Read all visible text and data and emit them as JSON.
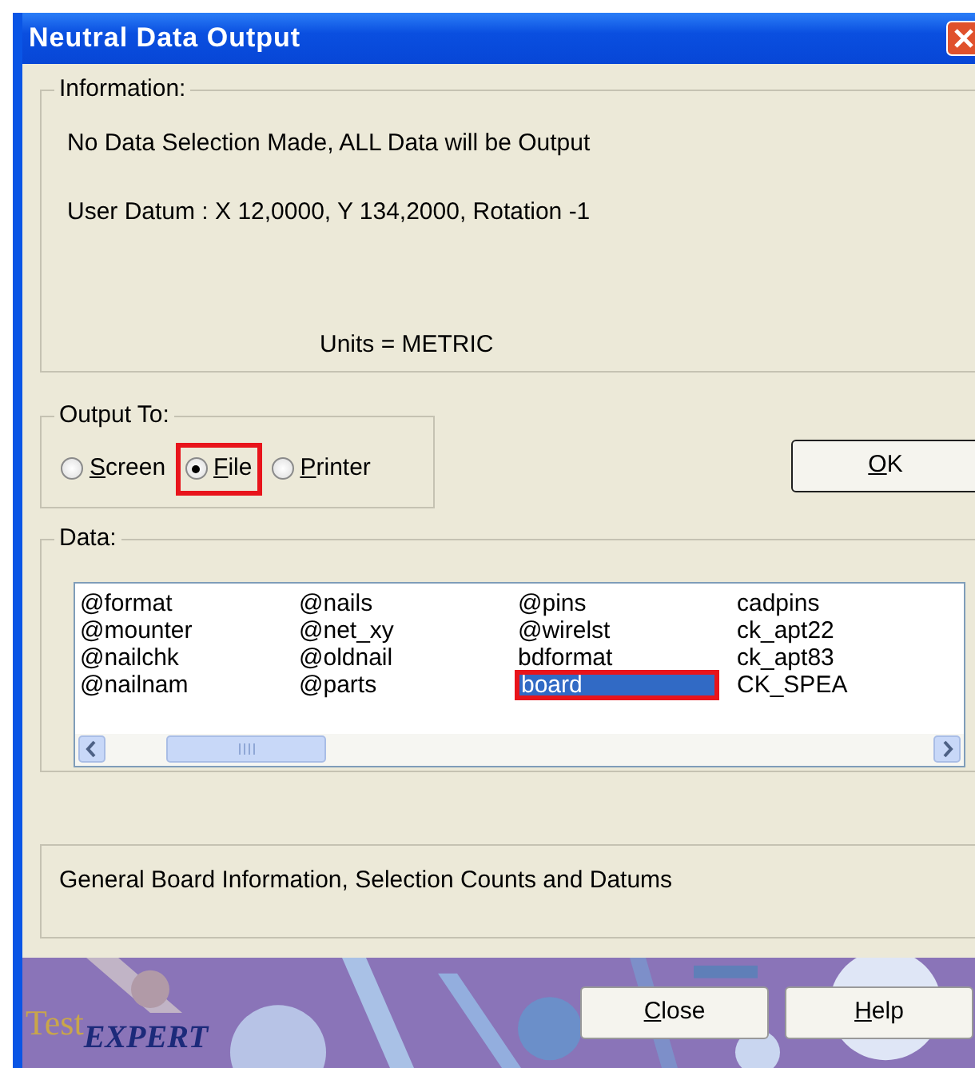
{
  "window": {
    "title": "Neutral Data Output"
  },
  "information": {
    "label": "Information:",
    "lines": [
      "No Data Selection Made, ALL Data will be Output",
      "User Datum : X 12,0000, Y 134,2000, Rotation -1"
    ],
    "units": "Units = METRIC"
  },
  "output_to": {
    "label": "Output To:",
    "options": [
      {
        "label": "Screen",
        "underline_first": true,
        "selected": false,
        "highlighted": false
      },
      {
        "label": "File",
        "underline_first": true,
        "selected": true,
        "highlighted": true
      },
      {
        "label": "Printer",
        "underline_first": true,
        "selected": false,
        "highlighted": false
      }
    ]
  },
  "ok_button": {
    "label": "OK",
    "underline_first": true
  },
  "data": {
    "label": "Data:",
    "columns": [
      [
        {
          "text": "@format",
          "selected": false,
          "highlighted": false
        },
        {
          "text": "@mounter",
          "selected": false,
          "highlighted": false
        },
        {
          "text": "@nailchk",
          "selected": false,
          "highlighted": false
        },
        {
          "text": "@nailnam",
          "selected": false,
          "highlighted": false
        }
      ],
      [
        {
          "text": "@nails",
          "selected": false,
          "highlighted": false
        },
        {
          "text": "@net_xy",
          "selected": false,
          "highlighted": false
        },
        {
          "text": "@oldnail",
          "selected": false,
          "highlighted": false
        },
        {
          "text": "@parts",
          "selected": false,
          "highlighted": false
        }
      ],
      [
        {
          "text": "@pins",
          "selected": false,
          "highlighted": false
        },
        {
          "text": "@wirelst",
          "selected": false,
          "highlighted": false
        },
        {
          "text": "bdformat",
          "selected": false,
          "highlighted": false
        },
        {
          "text": "board",
          "selected": true,
          "highlighted": true
        }
      ],
      [
        {
          "text": "cadpins",
          "selected": false,
          "highlighted": false
        },
        {
          "text": "ck_apt22",
          "selected": false,
          "highlighted": false
        },
        {
          "text": "ck_apt83",
          "selected": false,
          "highlighted": false
        },
        {
          "text": "CK_SPEA",
          "selected": false,
          "highlighted": false
        }
      ]
    ]
  },
  "description": "General Board Information, Selection Counts and Datums",
  "footer": {
    "logo": [
      "Test",
      "EXPERT"
    ],
    "buttons": [
      {
        "label": "Close",
        "underline_first": true
      },
      {
        "label": "Help",
        "underline_first": true
      }
    ]
  }
}
